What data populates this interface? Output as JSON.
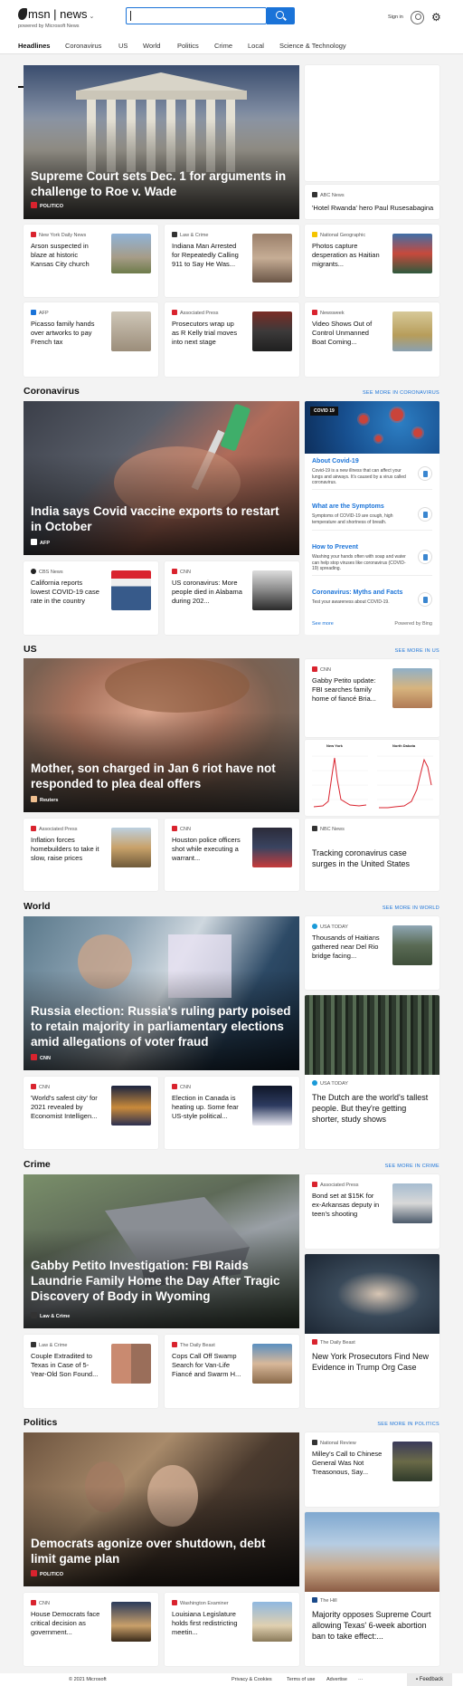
{
  "header": {
    "brand": "msn",
    "section": "news",
    "powered": "powered by Microsoft News",
    "search_value": "",
    "signin": "Sign in"
  },
  "nav": {
    "tabs": [
      "Headlines",
      "Coronavirus",
      "US",
      "World",
      "Politics",
      "Crime",
      "Local",
      "Science & Technology"
    ],
    "active": "Headlines"
  },
  "top": {
    "hero": {
      "title": "Supreme Court sets Dec. 1 for arguments in challenge to Roe v. Wade",
      "source": "POLITICO"
    },
    "side": {
      "source": "ABC News",
      "title": "'Hotel Rwanda' hero Paul Rusesabagina..."
    },
    "cards": [
      {
        "source": "New York Daily News",
        "title": "Arson suspected in blaze at historic Kansas City church"
      },
      {
        "source": "Law & Crime",
        "title": "Indiana Man Arrested for Repeatedly Calling 911 to Say He Was..."
      },
      {
        "source": "National Geographic",
        "title": "Photos capture desperation as Haitian migrants..."
      },
      {
        "source": "AFP",
        "title": "Picasso family hands over artworks to pay French tax"
      },
      {
        "source": "Associated Press",
        "title": "Prosecutors wrap up as R Kelly trial moves into next stage"
      },
      {
        "source": "Newsweek",
        "title": "Video Shows Out of Control Unmanned Boat Coming..."
      }
    ]
  },
  "coronavirus": {
    "heading": "Coronavirus",
    "see_more": "SEE MORE IN CORONAVIRUS",
    "hero": {
      "title": "India says Covid vaccine exports to restart in October",
      "source": "AFP"
    },
    "cards": [
      {
        "source": "CBS News",
        "title": "California reports lowest COVID-19 case rate in the country"
      },
      {
        "source": "CNN",
        "title": "US coronavirus: More people died in Alabama during 202..."
      }
    ],
    "panel": {
      "tag": "COVID 19",
      "items": [
        {
          "title": "About Covid-19",
          "desc": "Covid-19 is a new illness that can affect your lungs and airways. It's caused by a virus called coronavirus."
        },
        {
          "title": "What are the Symptoms",
          "desc": "Symptoms of COVID-19 are cough, high temperature and shortness of breath."
        },
        {
          "title": "How to Prevent",
          "desc": "Washing your hands often with soap and water can help stop viruses like coronavirus (COVID-19) spreading."
        },
        {
          "title": "Coronavirus: Myths and Facts",
          "desc": "Test your awareness about COVID-19."
        }
      ],
      "see_more": "See more",
      "powered": "Powered by Bing"
    }
  },
  "us": {
    "heading": "US",
    "see_more": "SEE MORE IN US",
    "hero": {
      "title": "Mother, son charged in Jan 6 riot have not responded to plea deal offers",
      "source": "Reuters"
    },
    "side": {
      "source": "CNN",
      "title": "Gabby Petito update: FBI searches family home of fiancé Bria..."
    },
    "chart_labels": [
      "New York",
      "North Dakota"
    ],
    "chart_card": {
      "source": "NBC News",
      "title": "Tracking coronavirus case surges in the United States"
    },
    "cards": [
      {
        "source": "Associated Press",
        "title": "Inflation forces homebuilders to take it slow, raise prices"
      },
      {
        "source": "CNN",
        "title": "Houston police officers shot while executing a warrant..."
      }
    ]
  },
  "world": {
    "heading": "World",
    "see_more": "SEE MORE IN WORLD",
    "hero": {
      "title": "Russia election: Russia's ruling party poised to retain majority in parliamentary elections amid allegations of voter fraud",
      "source": "CNN"
    },
    "side": {
      "source": "USA TODAY",
      "title": "Thousands of Haitians gathered near Del Rio bridge facing..."
    },
    "cards": [
      {
        "source": "CNN",
        "title": "'World's safest city' for 2021 revealed by Economist Intelligen..."
      },
      {
        "source": "CNN",
        "title": "Election in Canada is heating up. Some fear US-style political..."
      }
    ],
    "big": {
      "source": "USA TODAY",
      "title": "The Dutch are the world's tallest people. But they're getting shorter, study shows"
    }
  },
  "crime": {
    "heading": "Crime",
    "see_more": "SEE MORE IN CRIME",
    "hero": {
      "title": "Gabby Petito Investigation: FBI Raids Laundrie Family Home the Day After Tragic Discovery of Body in Wyoming",
      "source": "Law & Crime"
    },
    "side": {
      "source": "Associated Press",
      "title": "Bond set at $15K for ex-Arkansas deputy in teen's shooting"
    },
    "cards": [
      {
        "source": "Law & Crime",
        "title": "Couple Extradited to Texas in Case of 5-Year-Old Son Found..."
      },
      {
        "source": "The Daily Beast",
        "title": "Cops Call Off Swamp Search for Van-Life Fiancé and Swarm H..."
      }
    ],
    "big": {
      "source": "The Daily Beast",
      "title": "New York Prosecutors Find New Evidence in Trump Org Case"
    }
  },
  "politics": {
    "heading": "Politics",
    "see_more": "SEE MORE IN POLITICS",
    "hero": {
      "title": "Democrats agonize over shutdown, debt limit game plan",
      "source": "POLITICO"
    },
    "side": {
      "source": "National Review",
      "title": "Milley's Call to Chinese General Was Not Treasonous, Say..."
    },
    "cards": [
      {
        "source": "CNN",
        "title": "House Democrats face critical decision as government..."
      },
      {
        "source": "Washington Examiner",
        "title": "Louisiana Legislature holds first redistricting meetin..."
      }
    ],
    "big": {
      "source": "The Hill",
      "title": "Majority opposes Supreme Court allowing Texas' 6-week abortion ban to take effect:..."
    }
  },
  "footer": {
    "copyright": "© 2021 Microsoft",
    "links": [
      "Privacy & Cookies",
      "Terms of use",
      "Advertise",
      "···"
    ],
    "feedback": "Feedback"
  }
}
